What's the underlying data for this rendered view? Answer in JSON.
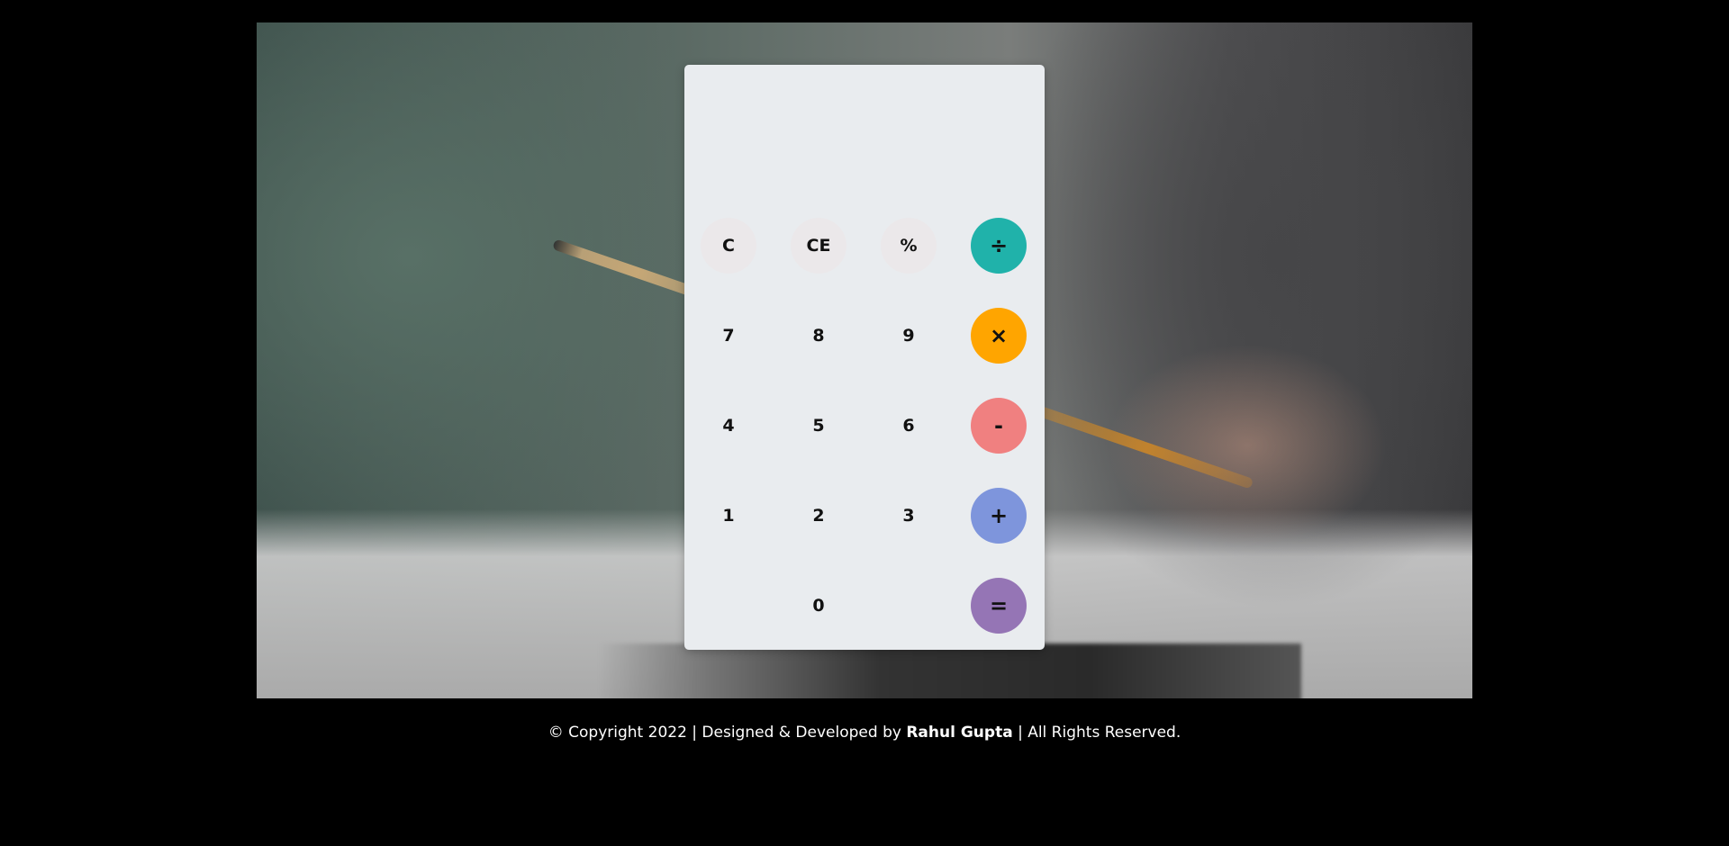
{
  "calculator": {
    "display_value": "",
    "keys": [
      {
        "label": "C",
        "role": "clear"
      },
      {
        "label": "CE",
        "role": "clear-entry"
      },
      {
        "label": "%",
        "role": "percent"
      },
      {
        "label": "÷",
        "role": "divide",
        "color": "#20b2aa"
      },
      {
        "label": "7",
        "role": "digit"
      },
      {
        "label": "8",
        "role": "digit"
      },
      {
        "label": "9",
        "role": "digit"
      },
      {
        "label": "×",
        "role": "multiply",
        "color": "#ffa500"
      },
      {
        "label": "4",
        "role": "digit"
      },
      {
        "label": "5",
        "role": "digit"
      },
      {
        "label": "6",
        "role": "digit"
      },
      {
        "label": "-",
        "role": "subtract",
        "color": "#f08080"
      },
      {
        "label": "1",
        "role": "digit"
      },
      {
        "label": "2",
        "role": "digit"
      },
      {
        "label": "3",
        "role": "digit"
      },
      {
        "label": "+",
        "role": "add",
        "color": "#7e95dc"
      },
      {
        "label": "0",
        "role": "digit"
      },
      {
        "label": "=",
        "role": "equals",
        "color": "#9575b5"
      }
    ]
  },
  "footer": {
    "prefix": "© Copyright 2022 | Designed & Developed by ",
    "author": "Rahul Gupta",
    "suffix": " | All Rights Reserved."
  }
}
